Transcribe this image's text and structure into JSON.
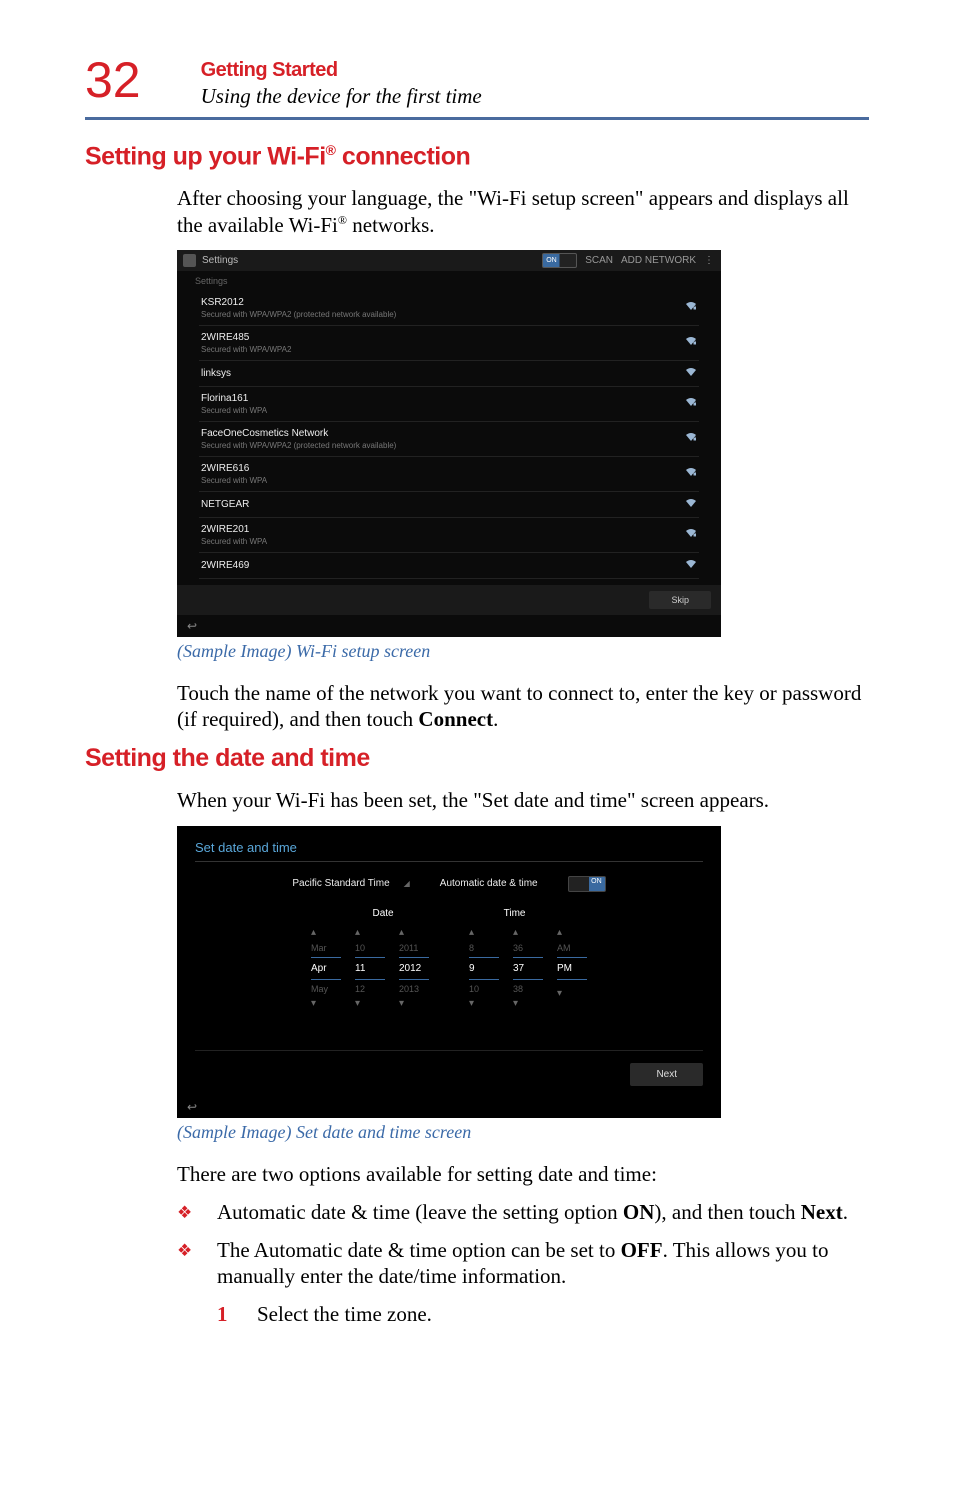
{
  "page_number": "32",
  "header": {
    "section": "Getting Started",
    "subsection": "Using the device for the first time"
  },
  "wifi_section": {
    "heading_pre": "Setting up your Wi-Fi",
    "heading_post": " connection",
    "intro_a": "After choosing your language, the \"Wi-Fi setup screen\" appears and displays all the available Wi-Fi",
    "intro_b": " networks.",
    "caption": "(Sample Image) Wi-Fi setup screen",
    "after_a": "Touch the name of the network you want to connect to, enter the key or password (if required), and then touch ",
    "after_connect": "Connect",
    "after_b": "."
  },
  "wifi_screenshot": {
    "topbar_label": "Settings",
    "toggle": "ON",
    "scan": "SCAN",
    "add": "ADD NETWORK",
    "header2": "Settings",
    "rows": [
      {
        "name": "KSR2012",
        "sub": "Secured with WPA/WPA2 (protected network available)",
        "lock": true
      },
      {
        "name": "2WIRE485",
        "sub": "Secured with WPA/WPA2",
        "lock": true
      },
      {
        "name": "linksys",
        "sub": "",
        "lock": false
      },
      {
        "name": "Florina161",
        "sub": "Secured with WPA",
        "lock": true
      },
      {
        "name": "FaceOneCosmetics Network",
        "sub": "Secured with WPA/WPA2 (protected network available)",
        "lock": true
      },
      {
        "name": "2WIRE616",
        "sub": "Secured with WPA",
        "lock": true
      },
      {
        "name": "NETGEAR",
        "sub": "",
        "lock": false
      },
      {
        "name": "2WIRE201",
        "sub": "Secured with WPA",
        "lock": true
      },
      {
        "name": "2WIRE469",
        "sub": "",
        "lock": false
      }
    ],
    "skip": "Skip"
  },
  "datetime_section": {
    "heading": "Setting the date and time",
    "intro": "When your Wi-Fi has been set, the \"Set date and time\" screen appears.",
    "caption": "(Sample Image) Set date and time screen",
    "options_intro": "There are two options available for setting date and time:",
    "bullet1_a": "Automatic date & time (leave the setting option ",
    "bullet1_on": "ON",
    "bullet1_b": "), and then touch ",
    "bullet1_next": "Next",
    "bullet1_c": ".",
    "bullet2_a": "The Automatic date & time option can be set to ",
    "bullet2_off": "OFF",
    "bullet2_b": ". This allows you to manually enter the date/time information.",
    "step1_num": "1",
    "step1_text": "Select the time zone."
  },
  "dt_screenshot": {
    "title": "Set date and time",
    "tz": "Pacific Standard Time",
    "auto_label": "Automatic date & time",
    "toggle": "ON",
    "date_label": "Date",
    "time_label": "Time",
    "date": {
      "prev": [
        "Mar",
        "10",
        "2011"
      ],
      "sel": [
        "Apr",
        "11",
        "2012"
      ],
      "next": [
        "May",
        "12",
        "2013"
      ]
    },
    "time": {
      "prev": [
        "8",
        "36",
        "AM"
      ],
      "sel": [
        "9",
        "37",
        "PM"
      ],
      "next": [
        "10",
        "38",
        ""
      ]
    },
    "next_btn": "Next"
  }
}
